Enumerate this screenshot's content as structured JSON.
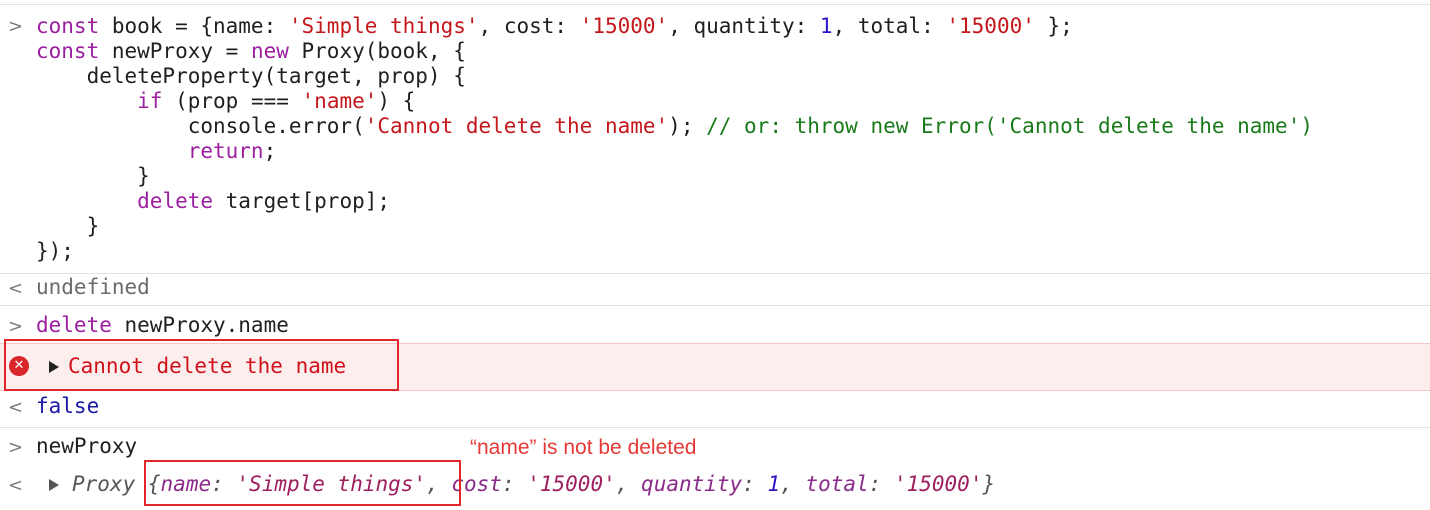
{
  "console": {
    "input1": {
      "lines": [
        {
          "parts": [
            [
              "kw",
              "const"
            ],
            [
              "plain",
              " book = {name: "
            ],
            [
              "str",
              "'Simple things'"
            ],
            [
              "plain",
              ", cost: "
            ],
            [
              "str",
              "'15000'"
            ],
            [
              "plain",
              ", quantity: "
            ],
            [
              "num",
              "1"
            ],
            [
              "plain",
              ", total: "
            ],
            [
              "str",
              "'15000'"
            ],
            [
              "plain",
              " };"
            ]
          ]
        },
        {
          "parts": [
            [
              "kw",
              "const"
            ],
            [
              "plain",
              " newProxy = "
            ],
            [
              "kw",
              "new"
            ],
            [
              "plain",
              " Proxy(book, {"
            ]
          ]
        },
        {
          "parts": [
            [
              "plain",
              "    deleteProperty(target, prop) {"
            ]
          ]
        },
        {
          "parts": [
            [
              "plain",
              "        "
            ],
            [
              "kw",
              "if"
            ],
            [
              "plain",
              " (prop === "
            ],
            [
              "str",
              "'name'"
            ],
            [
              "plain",
              ") {"
            ]
          ]
        },
        {
          "parts": [
            [
              "plain",
              "            console.error("
            ],
            [
              "str",
              "'Cannot delete the name'"
            ],
            [
              "plain",
              "); "
            ],
            [
              "cmt",
              "// or: throw new Error('Cannot delete the name')"
            ]
          ]
        },
        {
          "parts": [
            [
              "plain",
              "            "
            ],
            [
              "kw",
              "return"
            ],
            [
              "plain",
              ";"
            ]
          ]
        },
        {
          "parts": [
            [
              "plain",
              "        }"
            ]
          ]
        },
        {
          "parts": [
            [
              "plain",
              "        "
            ],
            [
              "kw",
              "delete"
            ],
            [
              "plain",
              " target[prop];"
            ]
          ]
        },
        {
          "parts": [
            [
              "plain",
              "    }"
            ]
          ]
        },
        {
          "parts": [
            [
              "plain",
              "});"
            ]
          ]
        }
      ]
    },
    "result1": "undefined",
    "input2": {
      "keyword": "delete",
      "rest": " newProxy.name"
    },
    "error_message": "Cannot delete the name",
    "result2": "false",
    "input3": "newProxy",
    "annotation": "“name” is not be deleted",
    "result3": {
      "label": "Proxy",
      "open": "{",
      "entries": [
        {
          "key": "name",
          "value": "'Simple things'",
          "type": "str"
        },
        {
          "key": "cost",
          "value": "'15000'",
          "type": "str"
        },
        {
          "key": "quantity",
          "value": "1",
          "type": "num"
        },
        {
          "key": "total",
          "value": "'15000'",
          "type": "str"
        }
      ],
      "close": "}"
    },
    "icons": {
      "input_prompt": "chevron-right-icon",
      "result_prompt": "chevron-left-icon",
      "error": "error-circle-icon",
      "expand": "triangle-right-icon"
    }
  }
}
